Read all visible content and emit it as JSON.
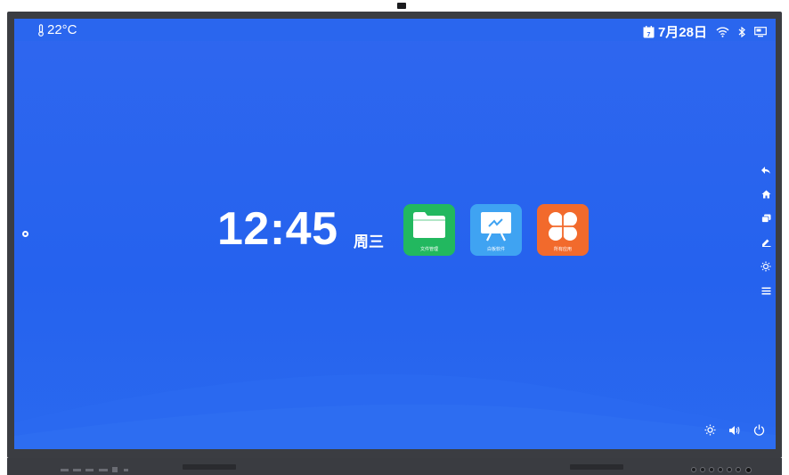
{
  "status_bar": {
    "temperature": "22°C",
    "date": "7月28日",
    "calendar_day": "7"
  },
  "home": {
    "time": "12:45",
    "weekday": "周三",
    "apps": [
      {
        "label": "文件管理",
        "color": "#22b85f",
        "icon": "folder-icon"
      },
      {
        "label": "白板软件",
        "color": "#3fa3f2",
        "icon": "whiteboard-icon"
      },
      {
        "label": "所有应用",
        "color": "#f26a2c",
        "icon": "apps-grid-icon"
      }
    ]
  },
  "sidebar": {
    "items": [
      "back-icon",
      "home-icon",
      "windows-icon",
      "pen-icon",
      "brightness-icon",
      "menu-icon"
    ]
  },
  "bottom_controls": [
    "brightness-icon",
    "volume-icon",
    "power-icon"
  ],
  "colors": {
    "screen_bg": "#2562ee",
    "bezel": "#3b3d42"
  }
}
